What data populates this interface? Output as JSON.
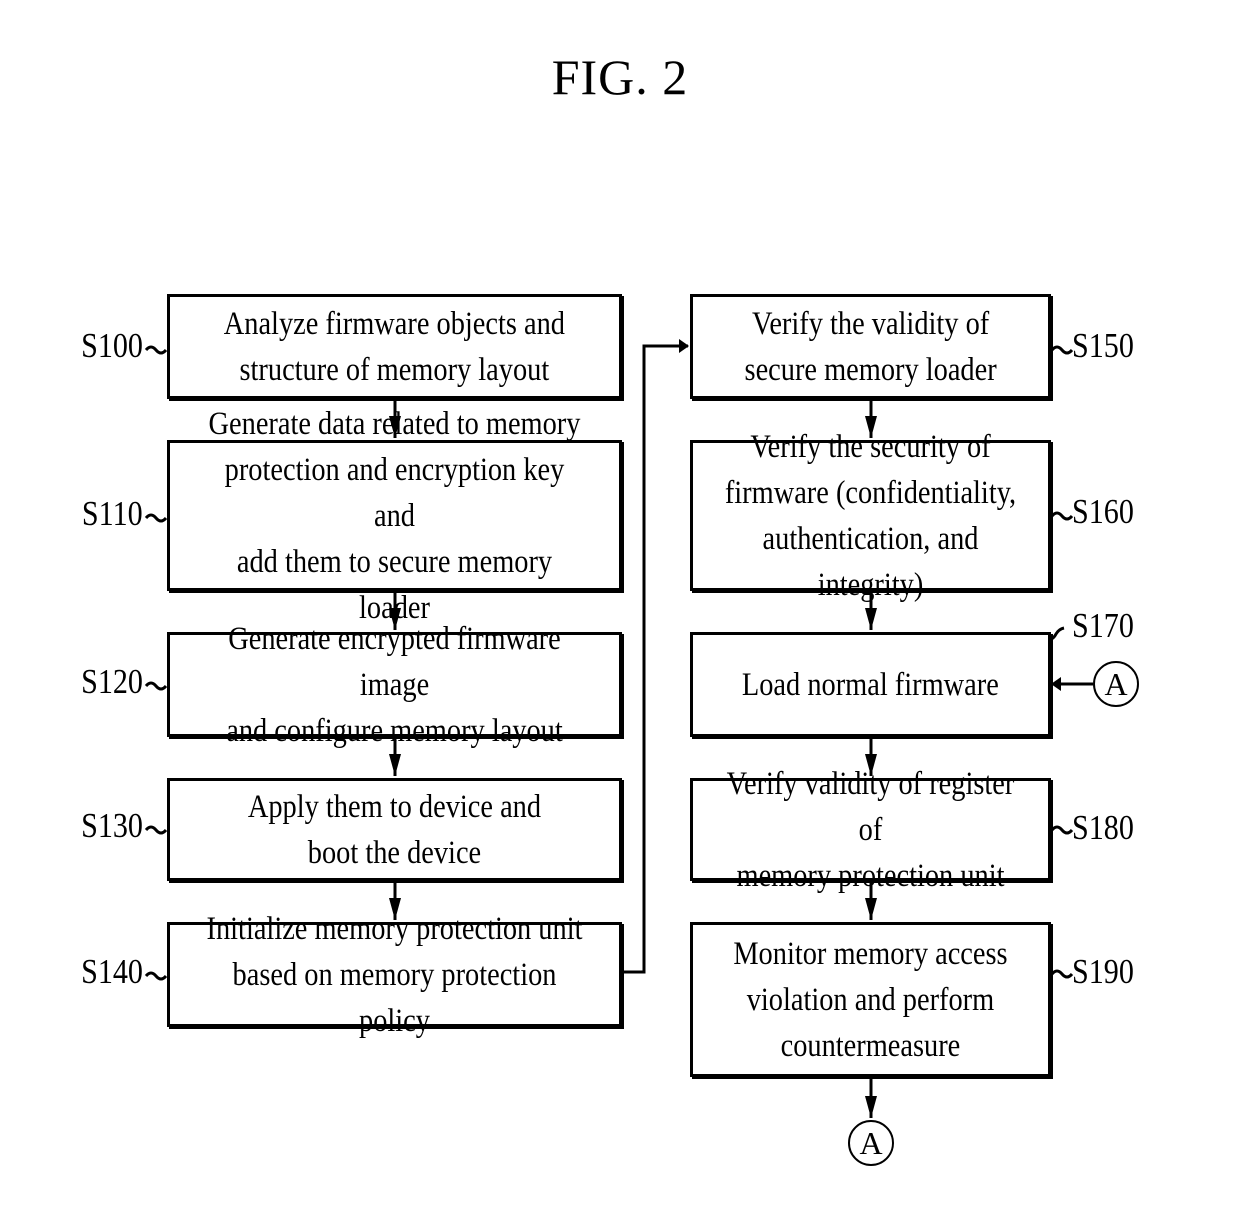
{
  "figure": {
    "title": "FIG. 2"
  },
  "steps": [
    {
      "id": "S100",
      "text": "Analyze firmware objects and\nstructure of memory layout"
    },
    {
      "id": "S110",
      "text": "Generate data related to memory\nprotection and encryption key and\nadd them to secure memory loader"
    },
    {
      "id": "S120",
      "text": "Generate encrypted firmware image\nand configure memory layout"
    },
    {
      "id": "S130",
      "text": "Apply them to device and\nboot the device"
    },
    {
      "id": "S140",
      "text": "Initialize memory protection unit\nbased on memory protection policy"
    },
    {
      "id": "S150",
      "text": "Verify the validity of\nsecure memory loader"
    },
    {
      "id": "S160",
      "text": "Verify the security of\nfirmware (confidentiality,\nauthentication, and integrity)"
    },
    {
      "id": "S170",
      "text": "Load normal firmware"
    },
    {
      "id": "S180",
      "text": "Verify validity of register of\nmemory protection unit"
    },
    {
      "id": "S190",
      "text": "Monitor memory access\nviolation and perform\ncountermeasure"
    }
  ],
  "connectors": {
    "loop_in": "A",
    "loop_out": "A"
  }
}
